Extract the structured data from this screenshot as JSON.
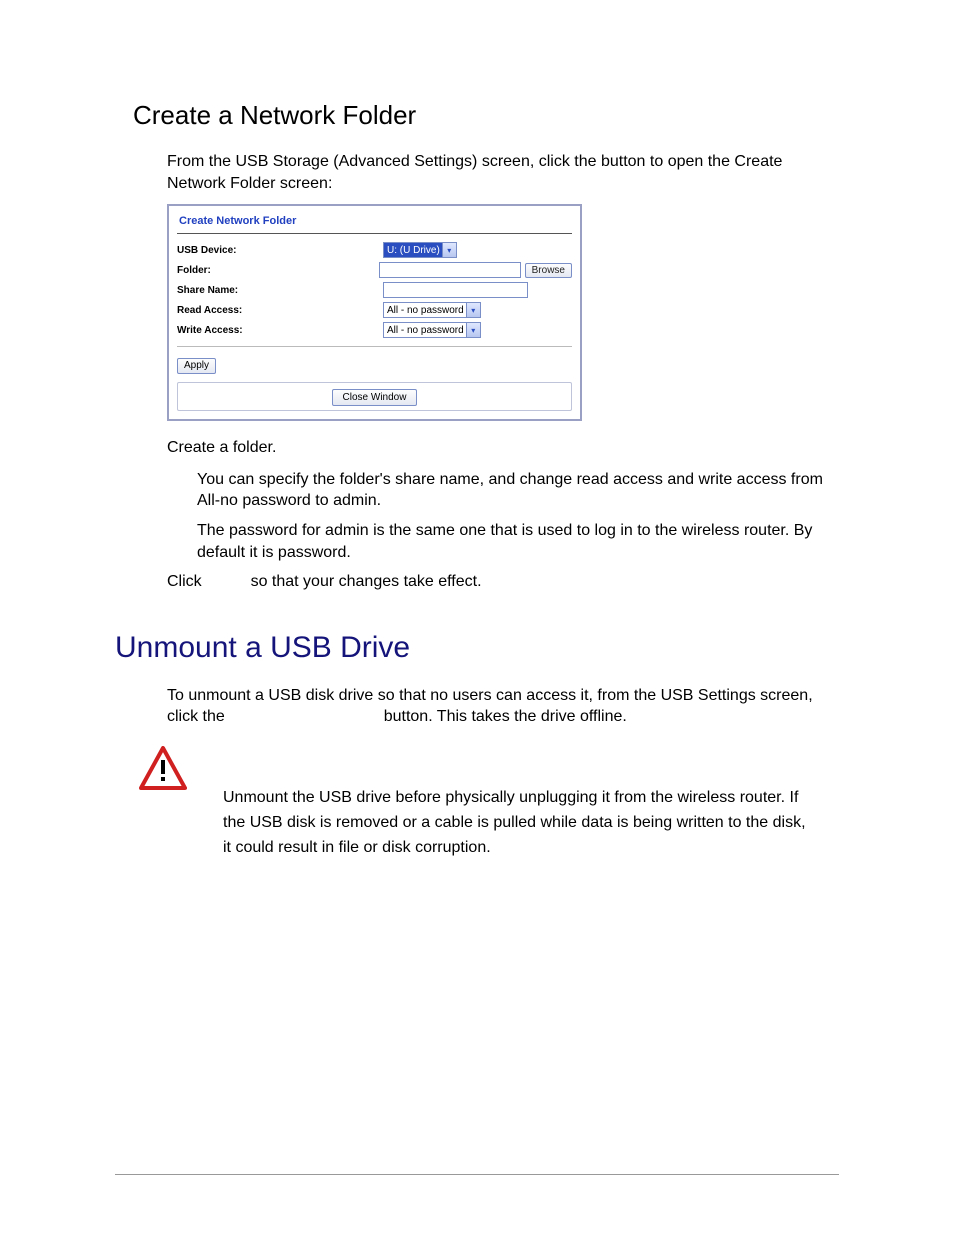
{
  "section1": {
    "heading": "Create a Network Folder",
    "intro": "From the USB Storage (Advanced Settings) screen, click the button to open the Create Network Folder screen:"
  },
  "dialog": {
    "title": "Create Network Folder",
    "rows": {
      "usb_device": {
        "label": "USB Device:",
        "value": "U: (U Drive)"
      },
      "folder": {
        "label": "Folder:",
        "browse": "Browse"
      },
      "share_name": {
        "label": "Share Name:"
      },
      "read": {
        "label": "Read Access:",
        "value": "All - no password"
      },
      "write": {
        "label": "Write Access:",
        "value": "All - no password"
      }
    },
    "apply": "Apply",
    "close": "Close Window"
  },
  "after_dialog": {
    "line1": "Create a folder.",
    "bullet1": "You can specify the folder's share name, and change read access and write access from All-no password to admin.",
    "bullet2": "The password for admin is the same one that is used to log in to the wireless router. By default it is password.",
    "line2a": "Click",
    "line2b": "so that your changes take effect."
  },
  "section2": {
    "heading": "Unmount a USB Drive",
    "p1a": "To unmount a USB disk drive so that no users can access it, from the USB Settings screen, click the",
    "p1b": "button. This takes the drive offline.",
    "warning": "Unmount the USB drive before physically unplugging it from the wireless router. If the USB disk is removed or a cable is pulled while data is being written to the disk, it could result in file or disk corruption."
  }
}
